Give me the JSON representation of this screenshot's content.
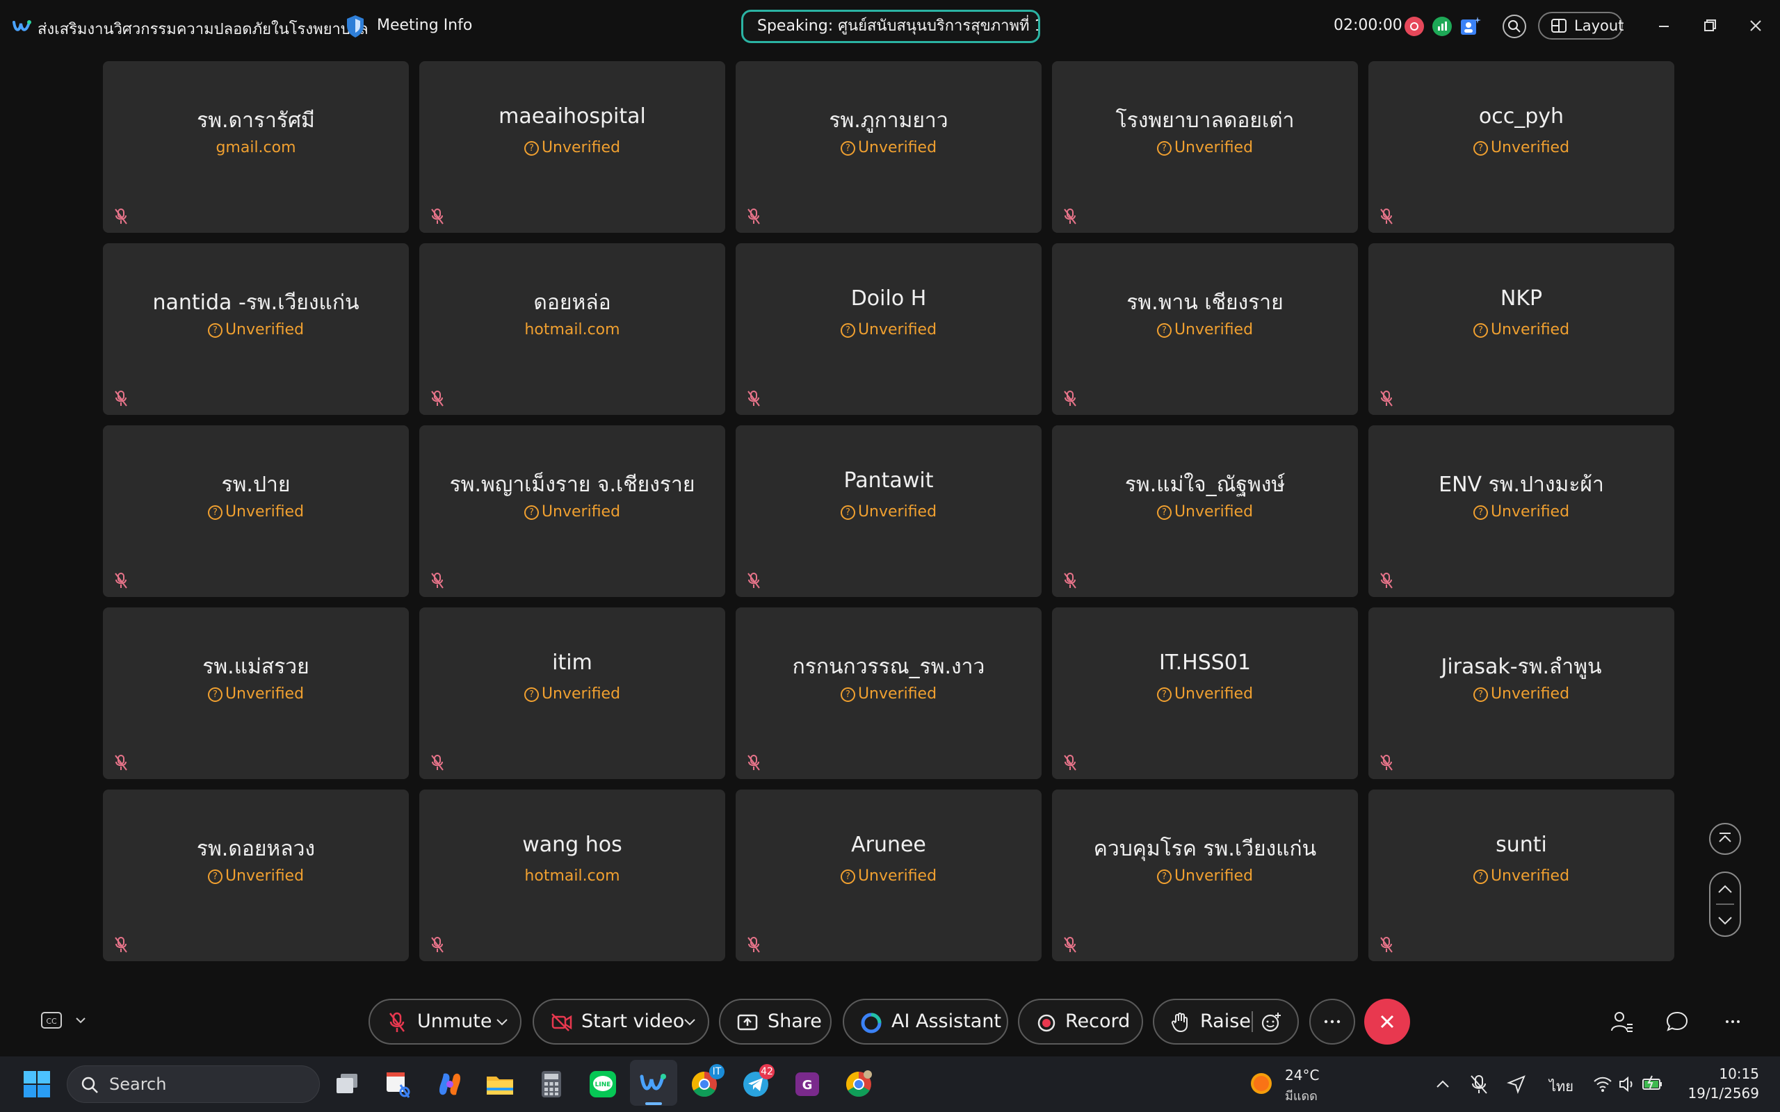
{
  "window": {
    "meeting_title": "ส่งเสริมงานวิศวกรรมความปลอดภัยในโรงพยาบาล",
    "meeting_info": "Meeting Info",
    "speaking": "Speaking: ศูนย์สนับสนุนบริการสุขภาพที่ 1",
    "timer": "02:00:00",
    "layout_label": "Layout"
  },
  "participants": [
    {
      "name": "รพ.ดารารัศมี",
      "sub": "gmail.com",
      "verified_icon": false
    },
    {
      "name": "maeaihospital",
      "sub": "Unverified",
      "verified_icon": true
    },
    {
      "name": "รพ.ภูกามยาว",
      "sub": "Unverified",
      "verified_icon": true
    },
    {
      "name": "โรงพยาบาลดอยเต่า",
      "sub": "Unverified",
      "verified_icon": true
    },
    {
      "name": "occ_pyh",
      "sub": "Unverified",
      "verified_icon": true
    },
    {
      "name": "nantida -รพ.เวียงแก่น",
      "sub": "Unverified",
      "verified_icon": true
    },
    {
      "name": "ดอยหล่อ",
      "sub": "hotmail.com",
      "verified_icon": false
    },
    {
      "name": "Doilo H",
      "sub": "Unverified",
      "verified_icon": true
    },
    {
      "name": "รพ.พาน เชียงราย",
      "sub": "Unverified",
      "verified_icon": true
    },
    {
      "name": "NKP",
      "sub": "Unverified",
      "verified_icon": true
    },
    {
      "name": "รพ.ปาย",
      "sub": "Unverified",
      "verified_icon": true
    },
    {
      "name": "รพ.พญาเม็งราย จ.เชียงราย",
      "sub": "Unverified",
      "verified_icon": true
    },
    {
      "name": "Pantawit",
      "sub": "Unverified",
      "verified_icon": true
    },
    {
      "name": "รพ.แม่ใจ_ณัฐพงษ์",
      "sub": "Unverified",
      "verified_icon": true
    },
    {
      "name": "ENV รพ.ปางมะผ้า",
      "sub": "Unverified",
      "verified_icon": true
    },
    {
      "name": "รพ.แม่สรวย",
      "sub": "Unverified",
      "verified_icon": true
    },
    {
      "name": "itim",
      "sub": "Unverified",
      "verified_icon": true
    },
    {
      "name": "กรกนกวรรณ_รพ.งาว",
      "sub": "Unverified",
      "verified_icon": true
    },
    {
      "name": "IT.HSS01",
      "sub": "Unverified",
      "verified_icon": true
    },
    {
      "name": "Jirasak-รพ.ลำพูน",
      "sub": "Unverified",
      "verified_icon": true
    },
    {
      "name": "รพ.ดอยหลวง",
      "sub": "Unverified",
      "verified_icon": true
    },
    {
      "name": "wang hos",
      "sub": "hotmail.com",
      "verified_icon": false
    },
    {
      "name": "Arunee",
      "sub": "Unverified",
      "verified_icon": true
    },
    {
      "name": "ควบคุมโรค รพ.เวียงแก่น",
      "sub": "Unverified",
      "verified_icon": true
    },
    {
      "name": "sunti",
      "sub": "Unverified",
      "verified_icon": true
    }
  ],
  "controls": {
    "unmute": "Unmute",
    "start_video": "Start video",
    "share": "Share",
    "ai_assistant": "AI Assistant",
    "record": "Record",
    "raise": "Raise"
  },
  "taskbar": {
    "search_label": "Search",
    "weather_temp": "24°C",
    "weather_desc": "มีแดด",
    "language": "ไทย",
    "time": "10:15",
    "date": "19/1/2569",
    "chrome_badge": "IT",
    "telegram_badge": "42"
  },
  "colors": {
    "accent_teal": "#2bb3a3",
    "unverified": "#f0a030",
    "end_call": "#e8384f",
    "tile_bg": "#2b2b2b"
  }
}
